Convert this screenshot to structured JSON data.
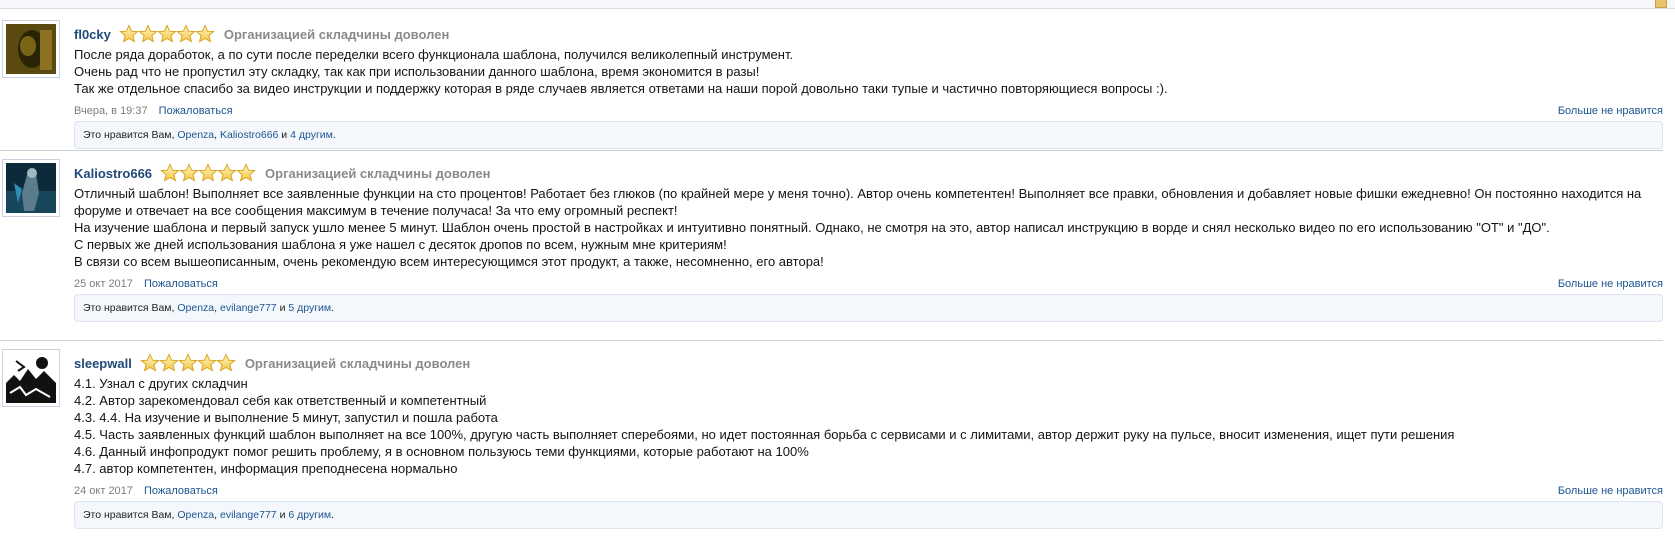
{
  "colors": {
    "link": "#1c5590",
    "username": "#214a7a",
    "verdict": "#8a8a8a",
    "border": "#c8d0dc",
    "likes_bg": "#f4f8fc"
  },
  "reviews": [
    {
      "username": "fl0cky",
      "rating": 5,
      "verdict": "Организацией складчины доволен",
      "lines": [
        "После ряда доработок, а по сути после переделки всего функционала шаблона, получился великолепный инструмент.",
        "Очень рад что не пропустил эту складку, так как при использовании данного шаблона, время экономится в разы!",
        "Так же отдельное спасибо за видео инструкции и поддержку которая в ряде случаев является ответами на наши порой довольно таки тупые и частично повторяющиеся вопросы :)."
      ],
      "date": "Вчера, в 19:37",
      "report": "Пожаловаться",
      "unlike": "Больше не нравится",
      "likes": {
        "prefix": "Это нравится Вам,",
        "user1": "Openza",
        "sep": ",",
        "user2": "Kaliostro666",
        "and": "и",
        "others": "4 другим",
        "end": "."
      }
    },
    {
      "username": "Kaliostro666",
      "rating": 5,
      "verdict": "Организацией складчины доволен",
      "lines": [
        "Отличный шаблон! Выполняет все заявленные функции на сто процентов! Работает без глюков (по крайней мере у меня точно). Автор очень компетентен! Выполняет все правки, обновления и добавляет новые фишки ежедневно! Он постоянно находится на форуме и отвечает на все сообщения максимум в течение получаса! За что ему огромный респект!",
        "На изучение шаблона и первый запуск ушло менее 5 минут. Шаблон очень простой в настройках и интуитивно понятный. Однако, не смотря на это, автор написал инструкцию в ворде и снял несколько видео по его использованию \"ОТ\" и \"ДО\".",
        "С первых же дней использования шаблона я уже нашел с десяток дропов по всем, нужным мне критериям!",
        "В связи со всем вышеописанным, очень рекомендую всем интересующимся этот продукт, а также, несомненно, его автора!"
      ],
      "date": "25 окт 2017",
      "report": "Пожаловаться",
      "unlike": "Больше не нравится",
      "likes": {
        "prefix": "Это нравится Вам,",
        "user1": "Openza",
        "sep": ",",
        "user2": "evilange777",
        "and": "и",
        "others": "5 другим",
        "end": "."
      }
    },
    {
      "username": "sleepwall",
      "rating": 5,
      "verdict": "Организацией складчины доволен",
      "lines": [
        "4.1. Узнал с других складчин",
        "4.2. Автор зарекомендовал себя как ответственный и компетентный",
        "4.3. 4.4. На изучение и выполнение 5 минут, запустил и пошла работа",
        "4.5. Часть заявленных функций шаблон выполняет на все 100%, другую часть выполняет сперебоями, но идет постоянная борьба с сервисами и с лимитами, автор держит руку на пульсе, вносит изменения, ищет пути решения",
        "4.6. Данный инфопродукт помог решить проблему, я в основном пользуюсь теми функциями, которые работают на 100%",
        "4.7. автор компетентен, информация преподнесена нормально"
      ],
      "date": "24 окт 2017",
      "report": "Пожаловаться",
      "unlike": "Больше не нравится",
      "likes": {
        "prefix": "Это нравится Вам,",
        "user1": "Openza",
        "sep": ",",
        "user2": "evilange777",
        "and": "и",
        "others": "6 другим",
        "end": "."
      }
    }
  ]
}
